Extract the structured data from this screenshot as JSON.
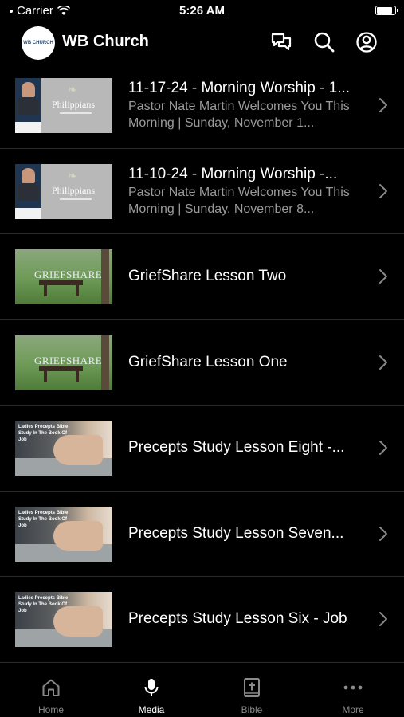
{
  "status_bar": {
    "carrier": "Carrier",
    "time": "5:26 AM",
    "battery_level": 0.9
  },
  "header": {
    "title": "WB Church",
    "logo_text": "WB CHURCH",
    "icons": [
      "chat-icon",
      "search-icon",
      "account-icon"
    ]
  },
  "items": [
    {
      "title": "11-17-24 - Morning Worship - 1...",
      "subtitle": "Pastor Nate Martin Welcomes You This Morning | Sunday, November 1...",
      "thumb_type": "philippians",
      "thumb_word": "Philippians"
    },
    {
      "title": "11-10-24 - Morning Worship -...",
      "subtitle": "Pastor Nate Martin Welcomes You This Morning | Sunday, November 8...",
      "thumb_type": "philippians",
      "thumb_word": "Philippians"
    },
    {
      "title": "GriefShare Lesson Two",
      "subtitle": "",
      "thumb_type": "griefshare",
      "thumb_word": "GRIEFSHARE"
    },
    {
      "title": "GriefShare Lesson One",
      "subtitle": "",
      "thumb_type": "griefshare",
      "thumb_word": "GRIEFSHARE"
    },
    {
      "title": "Precepts Study Lesson Eight -...",
      "subtitle": "",
      "thumb_type": "precepts",
      "thumb_word": "Ladies Precepts Bible Study In The Book Of Job"
    },
    {
      "title": "Precepts Study Lesson Seven...",
      "subtitle": "",
      "thumb_type": "precepts",
      "thumb_word": "Ladies Precepts Bible Study In The Book Of Job"
    },
    {
      "title": "Precepts Study Lesson Six - Job",
      "subtitle": "",
      "thumb_type": "precepts",
      "thumb_word": "Ladies Precepts Bible Study In The Book Of Job"
    }
  ],
  "tabs": [
    {
      "label": "Home",
      "icon": "home-icon",
      "active": false
    },
    {
      "label": "Media",
      "icon": "microphone-icon",
      "active": true
    },
    {
      "label": "Bible",
      "icon": "bible-icon",
      "active": false
    },
    {
      "label": "More",
      "icon": "more-icon",
      "active": false
    }
  ],
  "colors": {
    "background": "#000000",
    "text": "#ffffff",
    "subtext": "#9a9a9a",
    "divider": "#2b2b2b"
  }
}
